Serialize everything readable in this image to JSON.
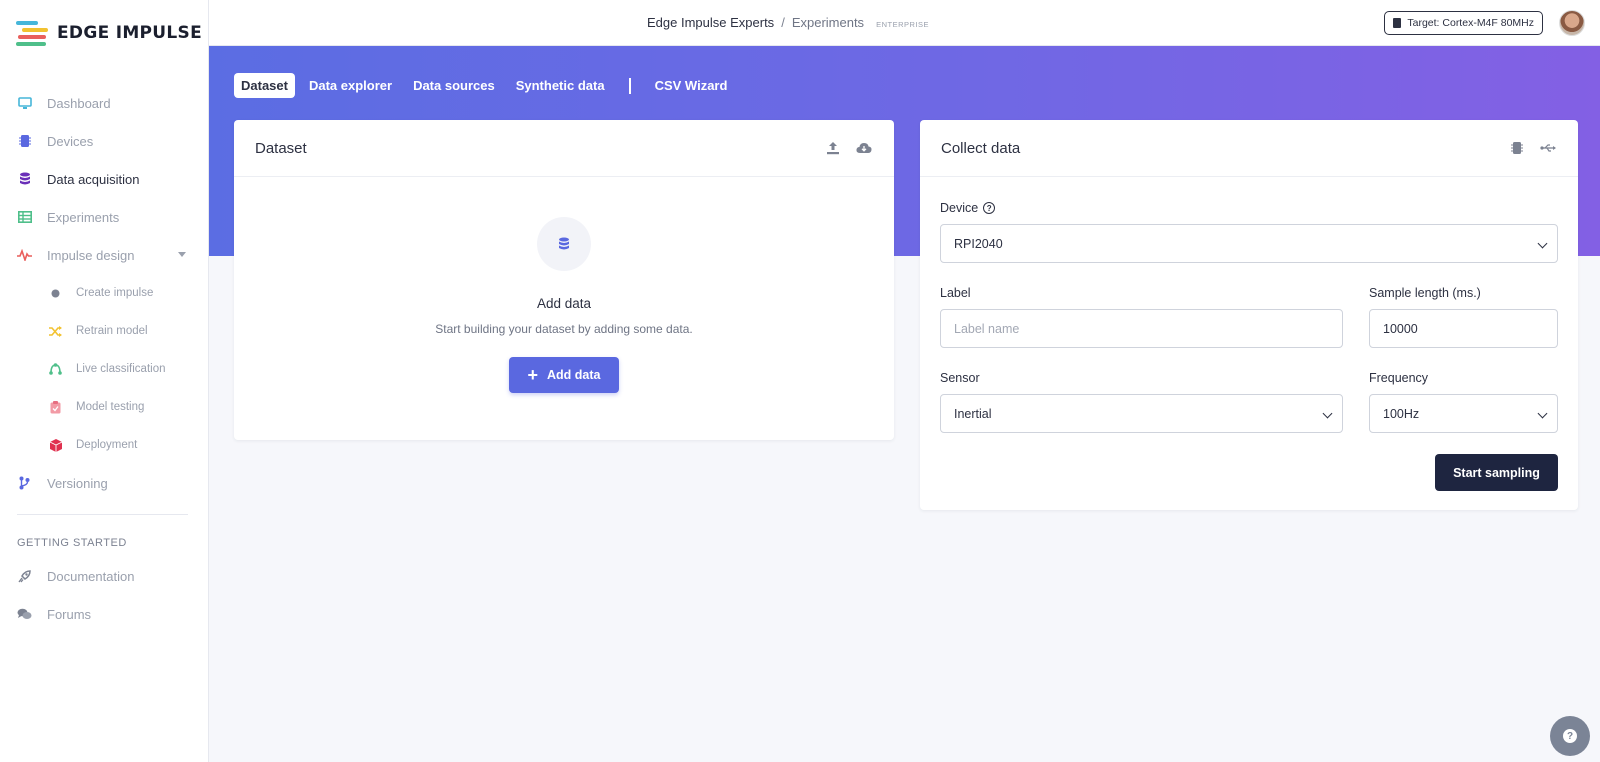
{
  "brand": {
    "name": "EDGE IMPULSE"
  },
  "sidebar": {
    "items": [
      {
        "label": "Dashboard",
        "icon": "monitor-icon"
      },
      {
        "label": "Devices",
        "icon": "chip-icon"
      },
      {
        "label": "Data acquisition",
        "icon": "database-icon"
      },
      {
        "label": "Experiments",
        "icon": "table-icon"
      },
      {
        "label": "Impulse design",
        "icon": "pulse-icon"
      }
    ],
    "sub_items": [
      {
        "label": "Create impulse",
        "icon": "dot-icon"
      },
      {
        "label": "Retrain model",
        "icon": "shuffle-icon"
      },
      {
        "label": "Live classification",
        "icon": "network-icon"
      },
      {
        "label": "Model testing",
        "icon": "clipboard-icon"
      },
      {
        "label": "Deployment",
        "icon": "cube-icon"
      }
    ],
    "versioning": {
      "label": "Versioning",
      "icon": "branch-icon"
    },
    "getting_started": {
      "heading": "GETTING STARTED",
      "items": [
        {
          "label": "Documentation",
          "icon": "rocket-icon"
        },
        {
          "label": "Forums",
          "icon": "chat-icon"
        }
      ]
    }
  },
  "topbar": {
    "project": "Edge Impulse Experts",
    "separator": "/",
    "section": "Experiments",
    "badge": "ENTERPRISE",
    "target": "Target: Cortex-M4F 80MHz"
  },
  "tabs": [
    "Dataset",
    "Data explorer",
    "Data sources",
    "Synthetic data",
    "CSV Wizard"
  ],
  "dataset_card": {
    "title": "Dataset",
    "empty_title": "Add data",
    "empty_subtitle": "Start building your dataset by adding some data.",
    "add_button": "Add data"
  },
  "collect_card": {
    "title": "Collect data",
    "device_label": "Device",
    "device_value": "RPI2040",
    "label_label": "Label",
    "label_placeholder": "Label name",
    "sample_length_label": "Sample length (ms.)",
    "sample_length_value": "10000",
    "sensor_label": "Sensor",
    "sensor_value": "Inertial",
    "frequency_label": "Frequency",
    "frequency_value": "100Hz",
    "start_button": "Start sampling"
  },
  "colors": {
    "accent": "#5a68e0",
    "hero_start": "#5b6de3",
    "hero_end": "#8360e4",
    "dark_button": "#1e2540"
  }
}
